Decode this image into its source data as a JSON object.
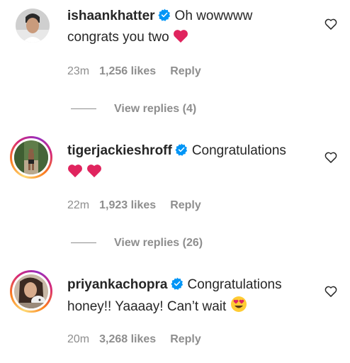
{
  "comments": [
    {
      "username": "ishaankhatter",
      "text_line1": "Oh wowwww",
      "text_line2": "congrats you two",
      "emoji_line2": "heart-emoji",
      "time": "23m",
      "likes": "1,256 likes",
      "reply": "Reply",
      "view_replies": "View replies (4)",
      "has_story": false
    },
    {
      "username": "tigerjackieshroff",
      "text_line1": "Congratulations",
      "text_line2": "",
      "emoji_line2": "two-heart-emojis",
      "time": "22m",
      "likes": "1,923 likes",
      "reply": "Reply",
      "view_replies": "View replies (26)",
      "has_story": true
    },
    {
      "username": "priyankachopra",
      "text_line1": "Congratulations",
      "text_line2": "honey!! Yaaaay! Can’t wait",
      "emoji_line2": "heart-eyes-emoji",
      "time": "20m",
      "likes": "3,268 likes",
      "reply": "Reply",
      "has_story": true
    }
  ],
  "colors": {
    "text": "#262626",
    "muted": "#8e8e8e",
    "verified": "#0095f6",
    "heart": "#ed4956"
  }
}
